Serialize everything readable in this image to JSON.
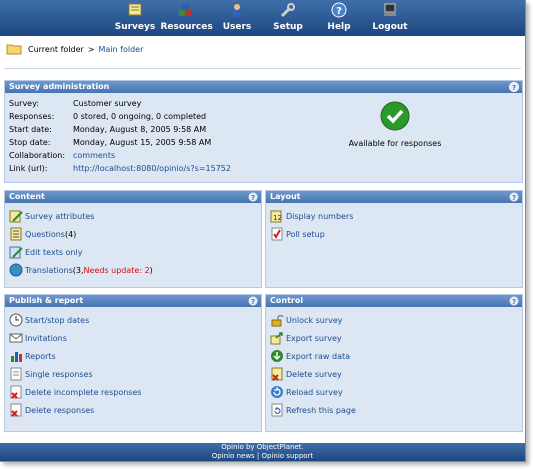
{
  "nav": {
    "items": [
      {
        "label": "Surveys",
        "icon": "surveys-icon"
      },
      {
        "label": "Resources",
        "icon": "resources-icon"
      },
      {
        "label": "Users",
        "icon": "users-icon"
      },
      {
        "label": "Setup",
        "icon": "setup-icon"
      },
      {
        "label": "Help",
        "icon": "help-icon"
      },
      {
        "label": "Logout",
        "icon": "logout-icon"
      }
    ]
  },
  "breadcrumb": {
    "current": "Current folder",
    "separator": ">",
    "link": "Main folder"
  },
  "survey_admin": {
    "title": "Survey administration",
    "rows": [
      {
        "label": "Survey:",
        "value": "Customer survey"
      },
      {
        "label": "Responses:",
        "value": "0 stored, 0 ongoing, 0 completed"
      },
      {
        "label": "Start date:",
        "value": "Monday, August 8, 2005 9:58 AM"
      },
      {
        "label": "Stop date:",
        "value": "Monday, August 15, 2005 9:58 AM"
      },
      {
        "label": "Collaboration:",
        "value": "comments"
      },
      {
        "label": "Link (url):",
        "value": "http://localhost:8080/opinio/s?s=15752"
      }
    ],
    "status": "Available for responses"
  },
  "content": {
    "title": "Content",
    "items": [
      {
        "label": "Survey attributes"
      },
      {
        "label": "Questions",
        "suffix": " (4)"
      },
      {
        "label": "Edit texts only"
      },
      {
        "label": "Translations",
        "suffix": " (3, ",
        "warning": "Needs update: 2",
        "suffix2": ")"
      }
    ]
  },
  "layout": {
    "title": "Layout",
    "items": [
      {
        "label": "Display numbers"
      },
      {
        "label": "Poll setup"
      }
    ]
  },
  "publish": {
    "title": "Publish & report",
    "items": [
      {
        "label": "Start/stop dates"
      },
      {
        "label": "Invitations"
      },
      {
        "label": "Reports"
      },
      {
        "label": "Single responses"
      },
      {
        "label": "Delete incomplete responses"
      },
      {
        "label": "Delete responses"
      }
    ]
  },
  "control": {
    "title": "Control",
    "items": [
      {
        "label": "Unlock survey"
      },
      {
        "label": "Export survey"
      },
      {
        "label": "Export raw data"
      },
      {
        "label": "Delete survey"
      },
      {
        "label": "Reload survey"
      },
      {
        "label": "Refresh this page"
      }
    ]
  },
  "footer": {
    "line1": "Opinio by ObjectPlanet.",
    "news": "Opinio news",
    "sep": " | ",
    "support": "Opinio support"
  },
  "colors": {
    "nav": "#1d4680",
    "panel_head": "#4675b3",
    "panel_bg": "#dde7f4",
    "link": "#1a4d8f",
    "warning": "#d01010"
  }
}
